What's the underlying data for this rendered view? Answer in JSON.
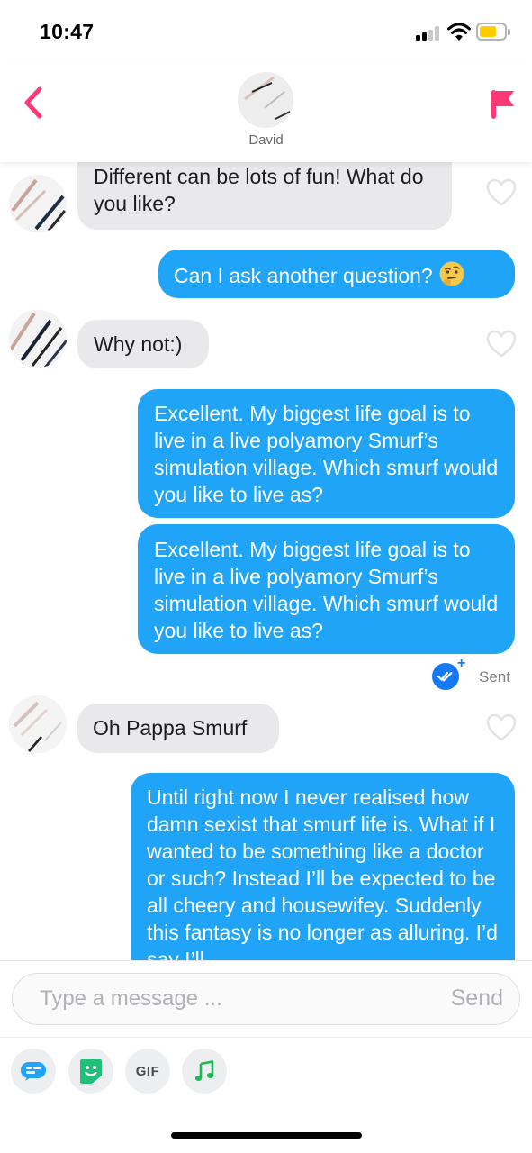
{
  "status_bar": {
    "time": "10:47"
  },
  "header": {
    "contact_name": "David"
  },
  "messages": [
    {
      "direction": "incoming",
      "text": "Different can be lots of fun! What do you like?"
    },
    {
      "direction": "outgoing",
      "text": "Can I ask another question?",
      "emoji": "thinking-face"
    },
    {
      "direction": "incoming",
      "text": "Why not:)"
    },
    {
      "direction": "outgoing",
      "text": "Excellent. My biggest life goal is to live in a live polyamory Smurf’s simulation village. Which smurf would you like to live as?"
    },
    {
      "direction": "outgoing",
      "text": "Excellent. My biggest life goal is to live in a live polyamory Smurf’s simulation village. Which smurf would you like to live as?",
      "status": "Sent"
    },
    {
      "direction": "incoming",
      "text": "Oh Pappa Smurf"
    },
    {
      "direction": "outgoing",
      "text": "Until right now I never realised how damn sexist that smurf life is. What if I wanted to be something like a doctor or such? Instead I’ll be expected to be all cheery and housewifey. Suddenly this fantasy is no longer as alluring. I’d say I’ll"
    }
  ],
  "composer": {
    "placeholder": "Type a message ...",
    "send_label": "Send",
    "gif_label": "GIF"
  },
  "colors": {
    "accent_pink": "#fd3a73",
    "outgoing_bubble": "#1fa4f7",
    "incoming_bubble": "#e9e9eb",
    "sent_check": "#1579f5",
    "sticker_green": "#21c07a",
    "music_green": "#1db954"
  }
}
